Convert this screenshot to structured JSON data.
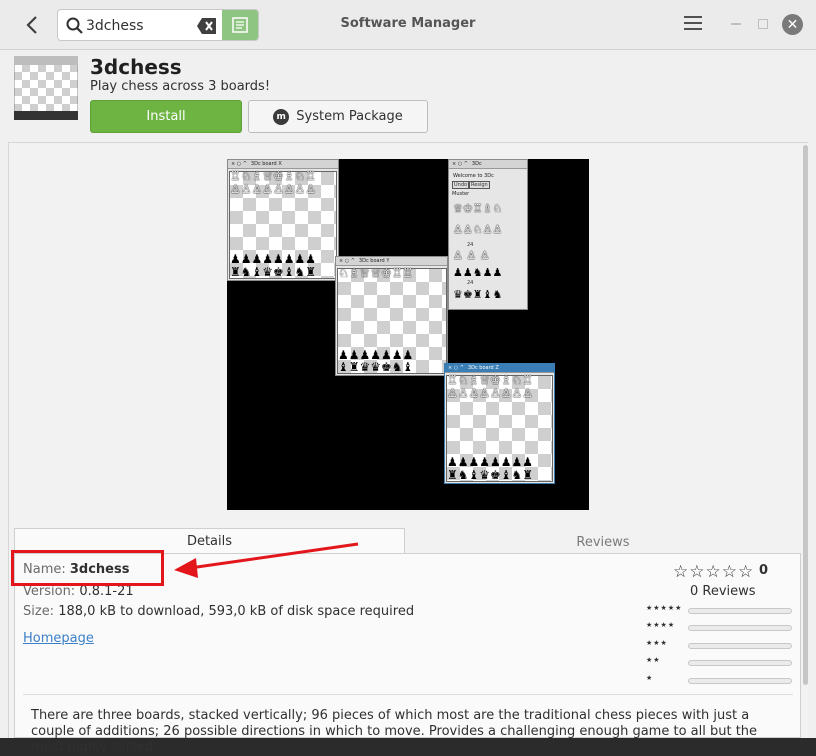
{
  "window": {
    "title": "Software Manager"
  },
  "search": {
    "value": "3dchess",
    "placeholder": ""
  },
  "app": {
    "name": "3dchess",
    "summary": "Play chess across 3 boards!",
    "install_label": "Install",
    "package_label": "System Package"
  },
  "screenshot": {
    "board_x_title": "3Dc board X",
    "board_y_title": "3Dc board Y",
    "board_z_title": "3Dc board Z",
    "panel_title": "3Dc",
    "panel_welcome": "Welcome to 3Dc",
    "panel_btn_undo": "Undo",
    "panel_btn_resign": "Resign",
    "panel_label": "Muster",
    "panel_count_1": "24",
    "panel_count_2": "24"
  },
  "tabs": [
    {
      "label": "Details",
      "active": true
    },
    {
      "label": "Reviews",
      "active": false
    }
  ],
  "details": {
    "name_label": "Name:",
    "name_value": "3dchess",
    "version_label": "Version:",
    "version_value": "0.8.1-21",
    "size_label": "Size:",
    "size_value": "188,0 kB to download, 593,0 kB of disk space required",
    "homepage_label": "Homepage"
  },
  "reviews": {
    "stars_display": "☆☆☆☆☆",
    "average": "0",
    "count_label": "0 Reviews",
    "breakdown": [
      {
        "stars": "★★★★★",
        "fraction": 0
      },
      {
        "stars": "★★★★",
        "fraction": 0
      },
      {
        "stars": "★★★",
        "fraction": 0
      },
      {
        "stars": "★★",
        "fraction": 0
      },
      {
        "stars": "★",
        "fraction": 0
      }
    ]
  },
  "description": "There are three boards, stacked vertically; 96 pieces of which most are the traditional chess pieces with just a couple of additions; 26 possible directions in which to move. Provides a challenging enough game to all but the most highly skilled",
  "colors": {
    "install": "#6db442",
    "annotation": "#e3161b",
    "link": "#3c80c8"
  }
}
